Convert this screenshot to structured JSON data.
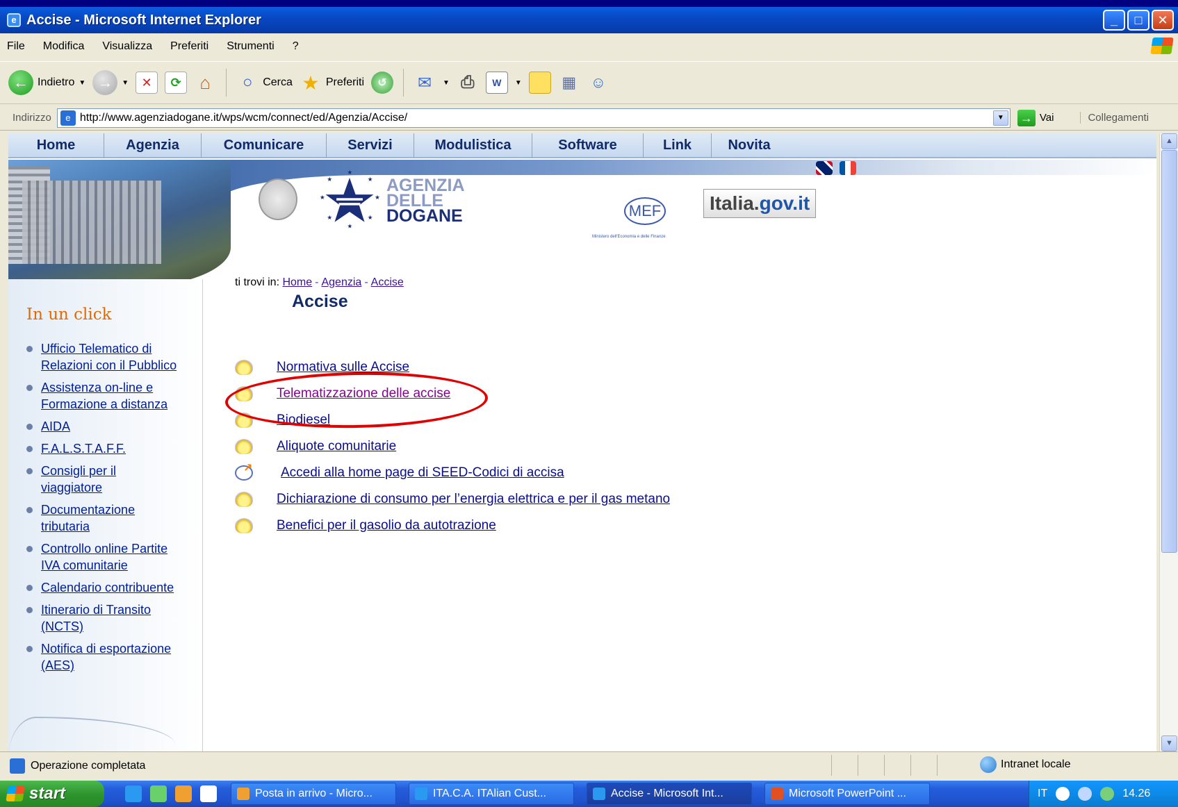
{
  "window": {
    "title": "Accise - Microsoft Internet Explorer",
    "buttons": [
      "_",
      "□",
      "✕"
    ]
  },
  "menu": [
    "File",
    "Modifica",
    "Visualizza",
    "Preferiti",
    "Strumenti",
    "?"
  ],
  "toolbar": {
    "back_label": "Indietro",
    "search_label": "Cerca",
    "favorites_label": "Preferiti"
  },
  "address": {
    "label": "Indirizzo",
    "url": "http://www.agenziadogane.it/wps/wcm/connect/ed/Agenzia/Accise/",
    "go_label": "Vai",
    "links_label": "Collegamenti"
  },
  "site": {
    "nav": [
      "Home",
      "Agenzia",
      "Comunicare",
      "Servizi",
      "Modulistica",
      "Software",
      "Link",
      "Novita"
    ],
    "logo_lines": [
      "AGENZIA",
      "DELLE",
      "DOGANE"
    ],
    "mef_label": "MEF",
    "mef_caption": "Ministero dell'Economia e delle Finanze",
    "italia_label": "Italia.",
    "italia_gov": "gov.it",
    "breadcrumb": {
      "prefix": "ti trovi in:",
      "items": [
        "Home",
        "Agenzia",
        "Accise"
      ]
    },
    "page_title": "Accise",
    "sidebar_title": "In un click",
    "sidebar_links": [
      "Ufficio Telematico di\nRelazioni con il Pubblico",
      "Assistenza on-line e\nFormazione a distanza",
      "AIDA",
      "F.A.L.S.T.A.F.F.",
      "Consigli per il\nviaggiatore",
      "Documentazione\ntributaria",
      "Controllo online Partite\nIVA comunitarie",
      "Calendario contribuente",
      "Itinerario di Transito\n(NCTS)",
      "Notifica di esportazione\n(AES)"
    ],
    "content_links": [
      "Normativa sulle Accise",
      "Telematizzazione delle accise",
      "Biodiesel",
      "Aliquote comunitarie",
      "Accedi alla home page di SEED-Codici di accisa",
      "Dichiarazione di consumo per l’energia elettrica e per il gas metano",
      "Benefici per il gasolio da autotrazione"
    ]
  },
  "status": {
    "text": "Operazione completata",
    "zone": "Intranet locale"
  },
  "taskbar": {
    "start_label": "start",
    "tasks": [
      "Posta in arrivo - Micro...",
      "ITA.C.A. ITAlian Cust...",
      "Accise - Microsoft Int...",
      "Microsoft PowerPoint ..."
    ],
    "lang": "IT",
    "clock": "14.26"
  },
  "colors": {
    "annotation": "#e00000",
    "link": "#0a0e88",
    "sidebar_title": "#e46a00"
  }
}
